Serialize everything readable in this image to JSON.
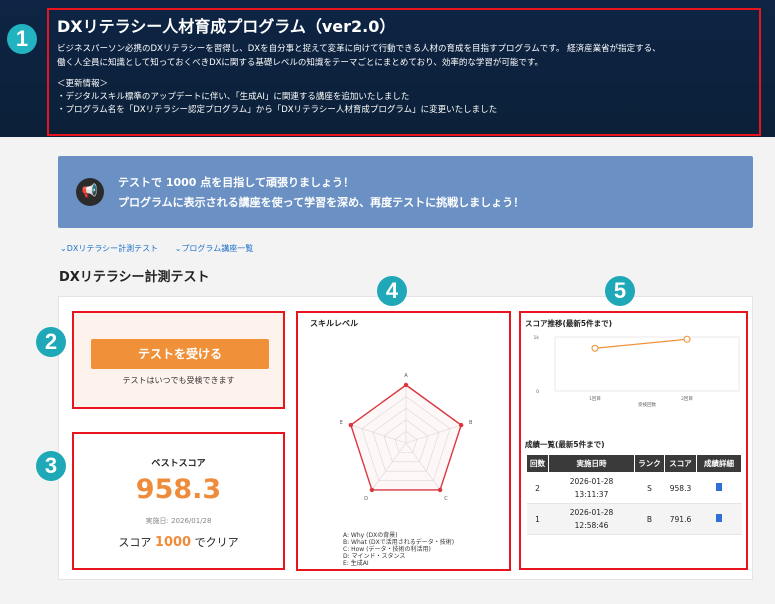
{
  "header": {
    "title": "DXリテラシー人材育成プログラム（ver2.0）",
    "desc1": "ビジネスパーソン必携のDXリテラシーを習得し、DXを自分事と捉えて変革に向けて行動できる人材の育成を目指すプログラムです。 経済産業省が指定する、",
    "desc2": "働く人全員に知識として知っておくべきDXに関する基礎レベルの知識をテーマごとにまとめており、効率的な学習が可能です。",
    "update_label": "＜更新情報＞",
    "update1": "・デジタルスキル標準のアップデートに伴い、「生成AI」に関連する講座を追加いたしました",
    "update2": "・プログラム名を「DXリテラシー認定プログラム」から「DXリテラシー人材育成プログラム」に変更いたしました"
  },
  "markers": {
    "n1": "1",
    "n2": "2",
    "n3": "3",
    "n4": "4",
    "n5": "5"
  },
  "banner": {
    "icon": "megaphone-icon",
    "line1": "テストで 1000 点を目指して頑張りましょう！",
    "line2": "プログラムに表示される講座を使って学習を深め、再度テストに挑戦しましょう！"
  },
  "links": {
    "test": "DXリテラシー計測テスト",
    "courses": "プログラム講座一覧"
  },
  "section_title": "DXリテラシー計測テスト",
  "test": {
    "button": "テストを受ける",
    "note": "テストはいつでも受検できます"
  },
  "best": {
    "label": "ベストスコア",
    "score": "958.3",
    "date": "実施日: 2026/01/28",
    "clear_prefix": "スコア",
    "clear_value": "1000",
    "clear_suffix": "でクリア"
  },
  "skill": {
    "title": "スキルレベル",
    "axes": [
      "A",
      "B",
      "C",
      "D",
      "E"
    ],
    "legend": [
      "A: Why (DXの背景)",
      "B: What (DXで活用されるデータ・技術)",
      "C: How (データ・技術の利活用)",
      "D: マインド・スタンス",
      "E: 生成AI"
    ]
  },
  "trend": {
    "title": "スコア推移(最新5件まで)",
    "y_top": "1k",
    "y_bottom": "0",
    "x_labels": [
      "1回目",
      "2回目"
    ],
    "x_title": "受検回数"
  },
  "list": {
    "title": "成績一覧(最新5件まで)",
    "headers": [
      "回数",
      "実施日時",
      "ランク",
      "スコア",
      "成績詳細"
    ],
    "rows": [
      {
        "n": "2",
        "date": "2026-01-28",
        "time": "13:11:37",
        "rank": "S",
        "score": "958.3"
      },
      {
        "n": "1",
        "date": "2026-01-28",
        "time": "12:58:46",
        "rank": "B",
        "score": "791.6"
      }
    ]
  },
  "chart_data": [
    {
      "type": "radar",
      "title": "スキルレベル",
      "categories": [
        "A",
        "B",
        "C",
        "D",
        "E"
      ],
      "values": [
        1,
        1,
        1,
        1,
        1
      ],
      "ylim": [
        0,
        1
      ]
    },
    {
      "type": "line",
      "title": "スコア推移(最新5件まで)",
      "categories": [
        "1回目",
        "2回目"
      ],
      "values": [
        791.6,
        958.3
      ],
      "xlabel": "受検回数",
      "ylim": [
        0,
        1000
      ]
    }
  ],
  "colors": {
    "accent": "#ef8c3c",
    "highlight": "#e8141e",
    "header_bg": "#0d2444",
    "banner_bg": "#6a90c4",
    "marker": "#1ea8b8"
  }
}
